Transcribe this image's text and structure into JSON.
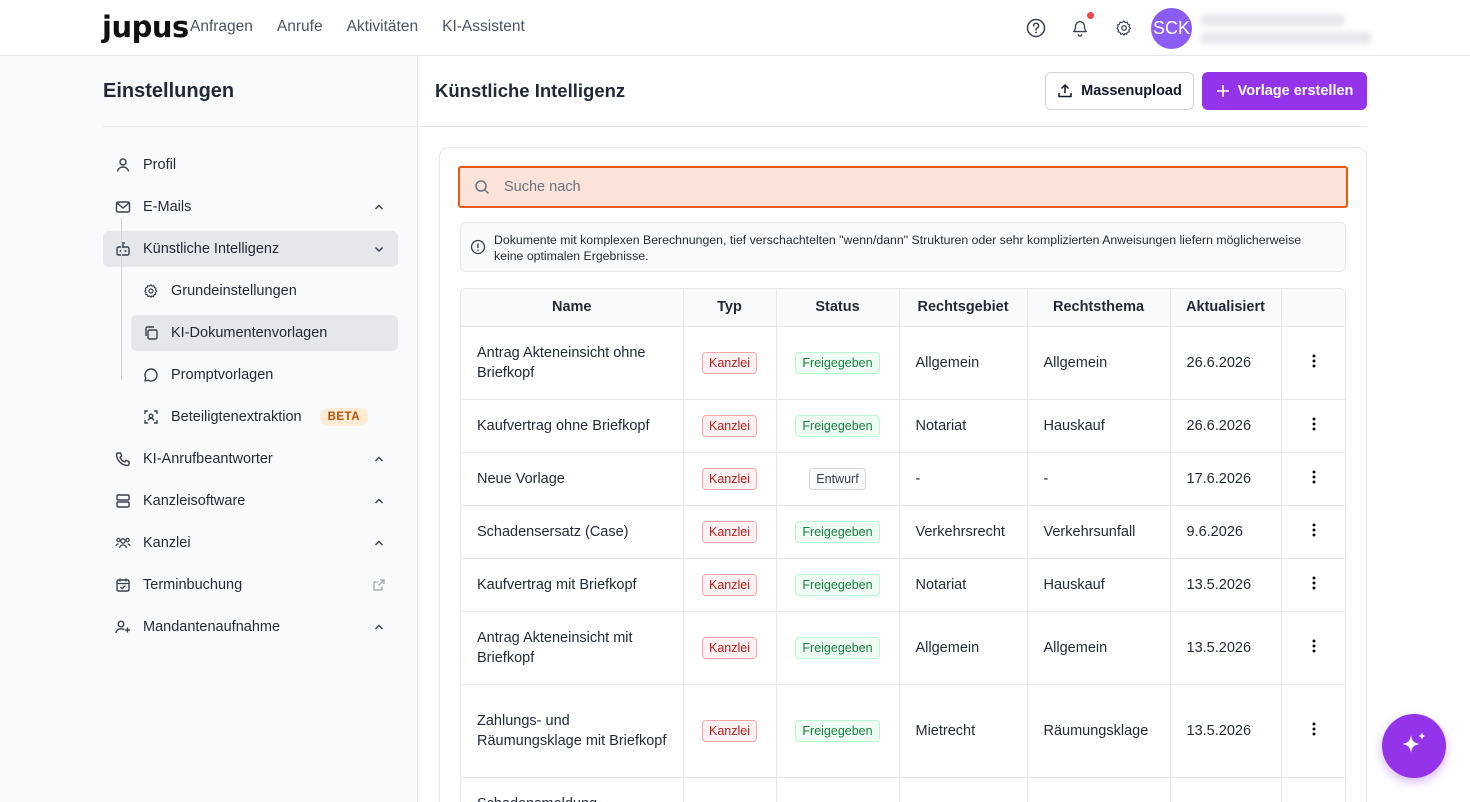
{
  "brand": {
    "logo_text": "jupus",
    "accent_color": "#9333ea"
  },
  "topnav": {
    "links": [
      "Anfragen",
      "Anrufe",
      "Aktivitäten",
      "KI-Assistent"
    ],
    "avatar_initials": "SCK",
    "icons": [
      "help-icon",
      "bell-icon",
      "gear-icon"
    ]
  },
  "sidebar": {
    "title": "Einstellungen",
    "items": [
      {
        "label": "Profil",
        "icon": "user-icon"
      },
      {
        "label": "E-Mails",
        "icon": "mail-icon"
      },
      {
        "label": "Künstliche Intelligenz",
        "icon": "robot-icon"
      },
      {
        "label": "KI-Anrufbeantworter",
        "icon": "phone-icon"
      },
      {
        "label": "Kanzleisoftware",
        "icon": "server-icon"
      },
      {
        "label": "Kanzlei",
        "icon": "team-icon"
      },
      {
        "label": "Terminbuchung",
        "icon": "calendar-icon"
      },
      {
        "label": "Mandantenaufnahme",
        "icon": "user-plus-icon"
      }
    ],
    "sub_items": [
      {
        "label": "Grundeinstellungen",
        "icon": "gear-icon"
      },
      {
        "label": "KI-Dokumentenvorlagen",
        "icon": "copy-icon"
      },
      {
        "label": "Promptvorlagen",
        "icon": "chat-icon"
      },
      {
        "label": "Beteiligtenextraktion",
        "icon": "scan-icon",
        "badge": "BETA"
      }
    ]
  },
  "main": {
    "title": "Künstliche Intelligenz",
    "mass_upload_label": "Massenupload",
    "create_label": "Vorlage erstellen",
    "search_placeholder": "Suche nach",
    "notice": "Dokumente mit komplexen Berechnungen, tief verschachtelten \"wenn/dann\" Strukturen oder sehr komplizierten Anweisungen liefern möglicherweise keine optimalen Ergebnisse."
  },
  "table": {
    "headers": [
      "Name",
      "Typ",
      "Status",
      "Rechtsgebiet",
      "Rechtsthema",
      "Aktualisiert"
    ],
    "rows": [
      {
        "name": "Antrag Akteneinsicht ohne Briefkopf",
        "typ": "Kanzlei",
        "status": "Freigegeben",
        "gebiet": "Allgemein",
        "thema": "Allgemein",
        "datum": "26.6.2026"
      },
      {
        "name": "Kaufvertrag ohne Briefkopf",
        "typ": "Kanzlei",
        "status": "Freigegeben",
        "gebiet": "Notariat",
        "thema": "Hauskauf",
        "datum": "26.6.2026"
      },
      {
        "name": "Neue Vorlage",
        "typ": "Kanzlei",
        "status": "Entwurf",
        "gebiet": "-",
        "thema": "-",
        "datum": "17.6.2026"
      },
      {
        "name": "Schadensersatz (Case)",
        "typ": "Kanzlei",
        "status": "Freigegeben",
        "gebiet": "Verkehrsrecht",
        "thema": "Verkehrsunfall",
        "datum": "9.6.2026"
      },
      {
        "name": "Kaufvertrag mit Briefkopf",
        "typ": "Kanzlei",
        "status": "Freigegeben",
        "gebiet": "Notariat",
        "thema": "Hauskauf",
        "datum": "13.5.2026"
      },
      {
        "name": "Antrag Akteneinsicht mit Briefkopf",
        "typ": "Kanzlei",
        "status": "Freigegeben",
        "gebiet": "Allgemein",
        "thema": "Allgemein",
        "datum": "13.5.2026"
      },
      {
        "name": "Zahlungs- und Räumungsklage mit Briefkopf",
        "typ": "Kanzlei",
        "status": "Freigegeben",
        "gebiet": "Mietrecht",
        "thema": "Räumungsklage",
        "datum": "13.5.2026"
      },
      {
        "name": "Schadensmeldung",
        "typ": "",
        "status": "",
        "gebiet": "",
        "thema": "",
        "datum": ""
      }
    ]
  }
}
